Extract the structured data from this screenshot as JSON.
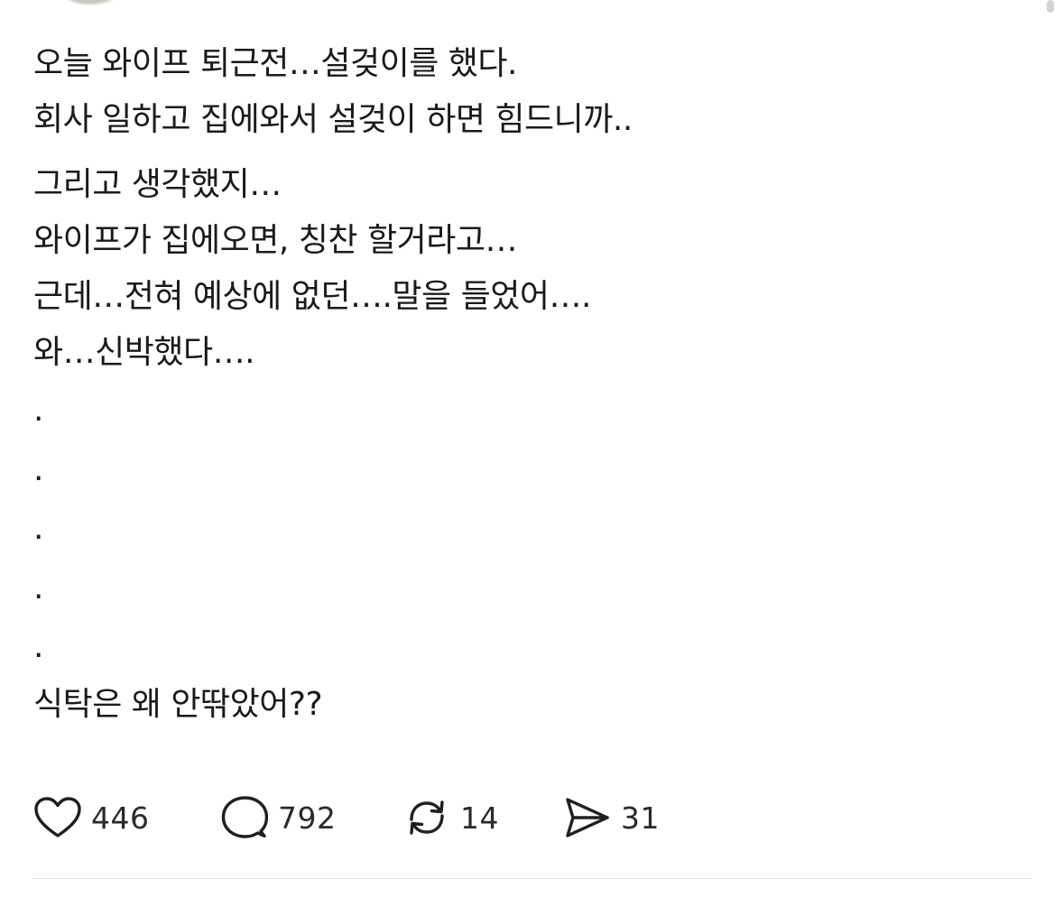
{
  "post": {
    "lines_a": [
      "오늘 와이프 퇴근전…설겆이를 했다.",
      "회사 일하고 집에와서 설겆이 하면 힘드니까.."
    ],
    "lines_b": [
      "그리고 생각했지…",
      "와이프가 집에오면, 칭찬 할거라고…",
      "근데…전혀 예상에 없던….말을 들었어….",
      "와…신박했다…."
    ],
    "dots": [
      ".",
      ".",
      ".",
      ".",
      "."
    ],
    "final_line": "식탁은 왜 안딲았어??"
  },
  "actions": {
    "like": {
      "icon": "heart-icon",
      "count": "446"
    },
    "comment": {
      "icon": "comment-bubble-icon",
      "count": "792"
    },
    "repost": {
      "icon": "repost-icon",
      "count": "14"
    },
    "share": {
      "icon": "send-icon",
      "count": "31"
    }
  },
  "colors": {
    "text": "#1a1a1a",
    "icon": "#1f1f1f",
    "divider": "#e2e2e2",
    "background": "#ffffff"
  }
}
